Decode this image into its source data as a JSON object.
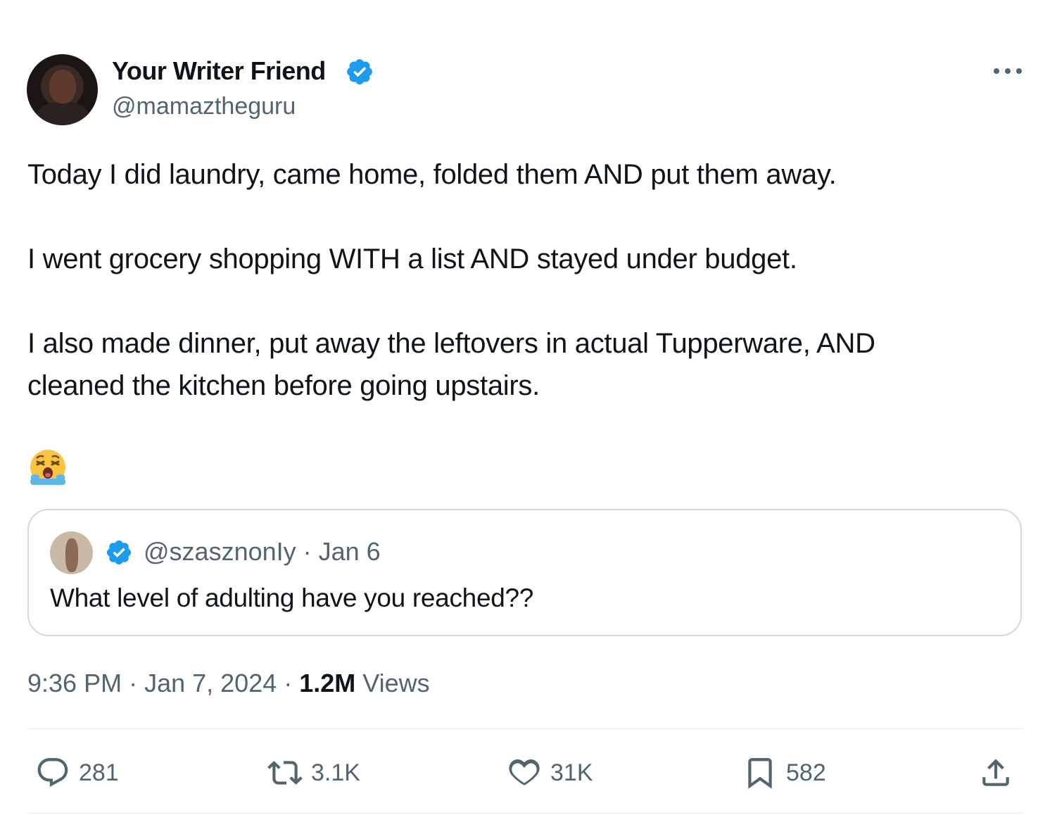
{
  "author": {
    "name": "Your Writer Friend",
    "handle": "@mamaztheguru",
    "verified": true
  },
  "tweet": {
    "paragraph1": "Today I did laundry, came home, folded them AND put them away.",
    "paragraph2": "I went grocery shopping WITH a list AND stayed under budget.",
    "paragraph3_line1": "I also made dinner, put away the leftovers in actual Tupperware, AND",
    "paragraph3_line2": "cleaned the kitchen before going upstairs.",
    "emoji": "loudly-crying-face-emoji"
  },
  "quoted_tweet": {
    "handle": "@szasznonIy",
    "separator": " · ",
    "date": "Jan 6",
    "verified": true,
    "text": "What level of adulting have you reached??"
  },
  "timestamp": {
    "time": "9:36 PM",
    "separator1": " · ",
    "date": "Jan 7, 2024",
    "separator2": " · ",
    "views_count": "1.2M",
    "views_label": " Views"
  },
  "actions": {
    "replies": "281",
    "reposts": "3.1K",
    "likes": "31K",
    "bookmarks": "582"
  },
  "colors": {
    "text": "#0f1419",
    "secondary": "#536471",
    "verified_blue": "#1d9bf0",
    "border": "#cfd9de",
    "emoji_yellow": "#f9c440",
    "emoji_tears": "#5db7ea"
  }
}
